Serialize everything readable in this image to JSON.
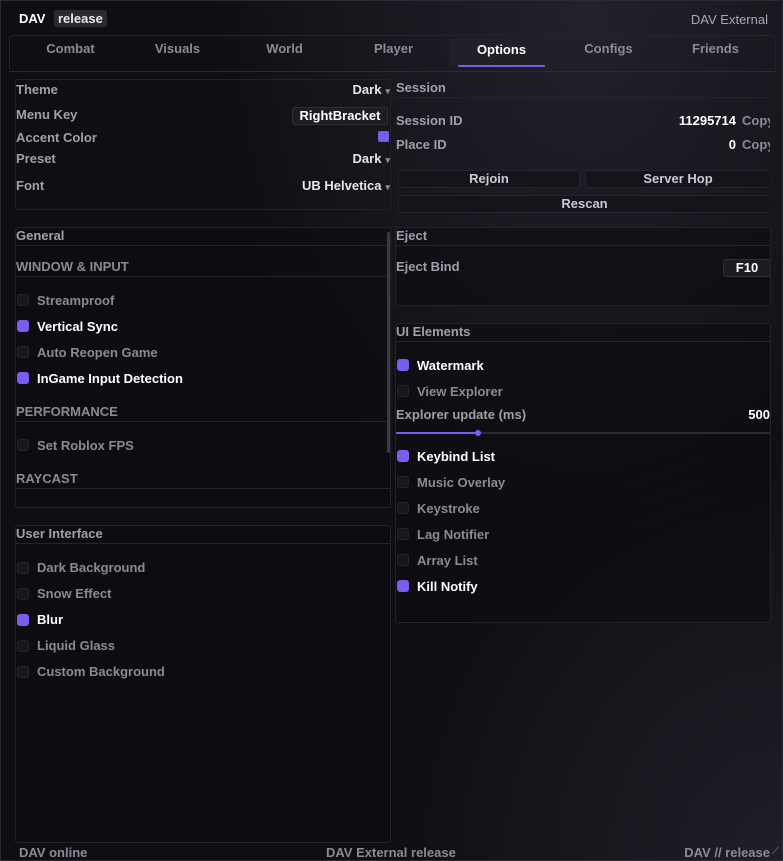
{
  "title": {
    "brand": "DAV",
    "badge": "release",
    "window_title": "DAV External"
  },
  "tabs": [
    {
      "label": "Combat"
    },
    {
      "label": "Visuals"
    },
    {
      "label": "World"
    },
    {
      "label": "Player"
    },
    {
      "label": "Options",
      "active": true
    },
    {
      "label": "Configs"
    },
    {
      "label": "Friends"
    }
  ],
  "appearance": {
    "theme_label": "Theme",
    "theme_value": "Dark",
    "menukey_label": "Menu Key",
    "menukey_value": "RightBracket",
    "accent_label": "Accent Color",
    "accent_color": "#7a5cf0",
    "preset_label": "Preset",
    "preset_value": "Dark",
    "font_label": "Font",
    "font_value": "UB Helvetica"
  },
  "general": {
    "title": "General",
    "window_input": "WINDOW & INPUT",
    "items_window": [
      {
        "label": "Streamproof",
        "checked": false
      },
      {
        "label": "Vertical Sync",
        "checked": true
      },
      {
        "label": "Auto Reopen Game",
        "checked": false
      },
      {
        "label": "InGame Input Detection",
        "checked": true
      }
    ],
    "performance": "PERFORMANCE",
    "items_perf": [
      {
        "label": "Set Roblox FPS",
        "checked": false
      }
    ],
    "raycast": "RAYCAST"
  },
  "user_interface": {
    "title": "User Interface",
    "items": [
      {
        "label": "Dark Background",
        "checked": false
      },
      {
        "label": "Snow Effect",
        "checked": false
      },
      {
        "label": "Blur",
        "checked": true
      },
      {
        "label": "Liquid Glass",
        "checked": false
      },
      {
        "label": "Custom Background",
        "checked": false
      }
    ]
  },
  "session": {
    "title": "Session",
    "session_id_label": "Session ID",
    "session_id_value": "11295714",
    "copy1": "Copy",
    "place_id_label": "Place ID",
    "place_id_value": "0",
    "copy2": "Copy",
    "rejoin": "Rejoin",
    "server_hop": "Server Hop",
    "rescan": "Rescan"
  },
  "eject": {
    "title": "Eject",
    "bind_label": "Eject Bind",
    "bind_value": "F10"
  },
  "ui_elements": {
    "title": "UI Elements",
    "items_top": [
      {
        "label": "Watermark",
        "checked": true
      },
      {
        "label": "View Explorer",
        "checked": false
      }
    ],
    "explorer_label": "Explorer update (ms)",
    "explorer_value": "500",
    "explorer_fraction": 0.22,
    "items_bottom": [
      {
        "label": "Keybind List",
        "checked": true
      },
      {
        "label": "Music Overlay",
        "checked": false
      },
      {
        "label": "Keystroke",
        "checked": false
      },
      {
        "label": "Lag Notifier",
        "checked": false
      },
      {
        "label": "Array List",
        "checked": false
      },
      {
        "label": "Kill Notify",
        "checked": true
      }
    ]
  },
  "footer": {
    "left": "DAV online",
    "center": "DAV External release",
    "right": "DAV // release"
  }
}
